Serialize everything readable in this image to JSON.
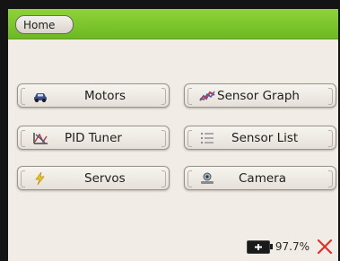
{
  "header": {
    "home_label": "Home"
  },
  "buttons": {
    "motors": {
      "label": "Motors",
      "icon": "car-icon"
    },
    "sensor_graph": {
      "label": "Sensor Graph",
      "icon": "graph-icon"
    },
    "pid_tuner": {
      "label": "PID Tuner",
      "icon": "pid-icon"
    },
    "sensor_list": {
      "label": "Sensor List",
      "icon": "list-icon"
    },
    "servos": {
      "label": "Servos",
      "icon": "bolt-icon"
    },
    "camera": {
      "label": "Camera",
      "icon": "camera-icon"
    }
  },
  "status": {
    "battery_percent": "97.7%"
  },
  "colors": {
    "header_green": "#7cc52c",
    "background": "#f1ece6",
    "close_red": "#e0302a"
  }
}
